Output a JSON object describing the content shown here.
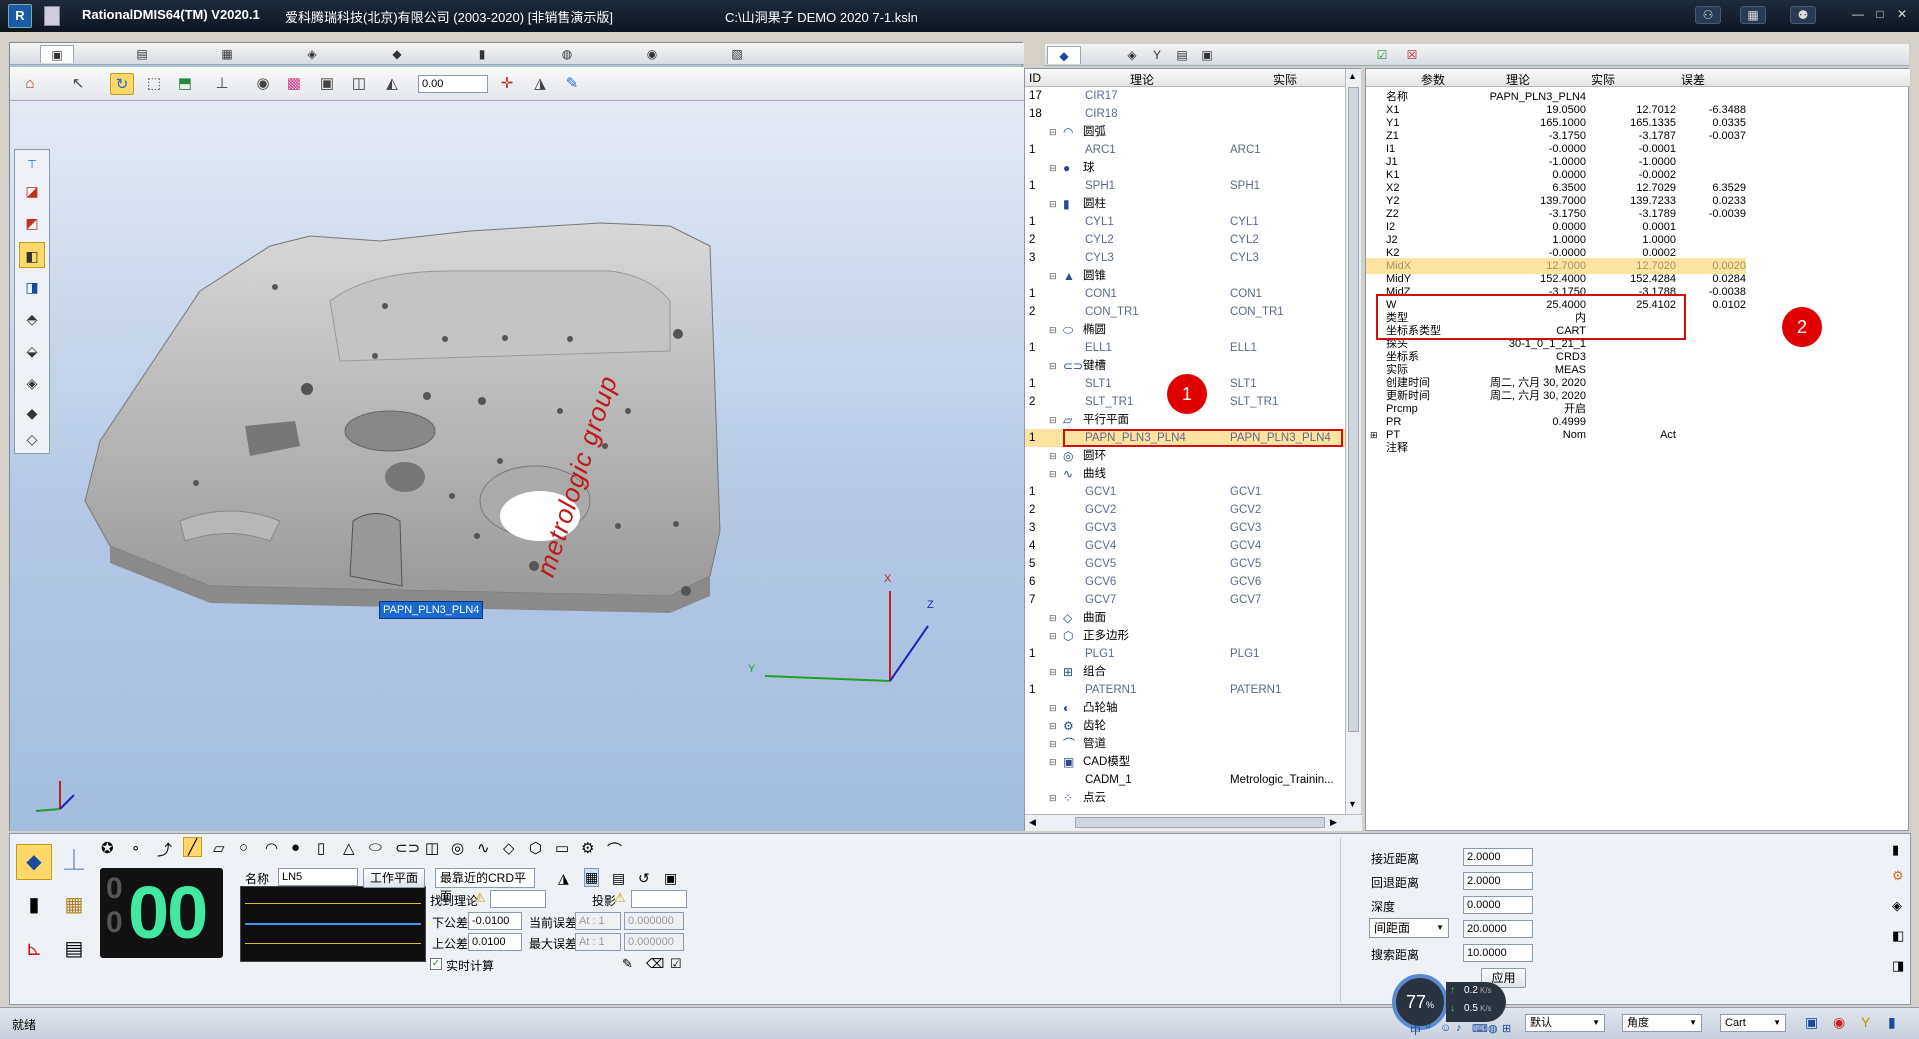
{
  "titlebar": {
    "app_title": "RationalDMIS64(TM) V2020.1",
    "company": "爱科腾瑞科技(北京)有限公司 (2003-2020) [非销售演示版]",
    "file_path": "C:\\山洞果子 DEMO  2020  7-1.ksln",
    "minimize": "—",
    "maximize": "□",
    "close": "✕"
  },
  "toolbar": {
    "zoom_value": "0.00"
  },
  "viewport": {
    "feature_label": "PAPN_PLN3_PLN4",
    "brand_text": "metrologic group",
    "axis_x": "X",
    "axis_y": "Y",
    "axis_z": "Z"
  },
  "tree": {
    "headers": {
      "id": "ID",
      "nominal": "理论",
      "actual": "实际"
    },
    "rows": [
      {
        "id": "17",
        "name": "CIR17",
        "actual": "",
        "group": false
      },
      {
        "id": "18",
        "name": "CIR18",
        "actual": "",
        "group": false
      },
      {
        "id": "",
        "name": "圆弧",
        "actual": "",
        "group": true,
        "icon": "◠"
      },
      {
        "id": "1",
        "name": "ARC1",
        "actual": "ARC1",
        "group": false
      },
      {
        "id": "",
        "name": "球",
        "actual": "",
        "group": true,
        "icon": "●"
      },
      {
        "id": "1",
        "name": "SPH1",
        "actual": "SPH1",
        "group": false
      },
      {
        "id": "",
        "name": "圆柱",
        "actual": "",
        "group": true,
        "icon": "▮"
      },
      {
        "id": "1",
        "name": "CYL1",
        "actual": "CYL1",
        "group": false
      },
      {
        "id": "2",
        "name": "CYL2",
        "actual": "CYL2",
        "group": false
      },
      {
        "id": "3",
        "name": "CYL3",
        "actual": "CYL3",
        "group": false
      },
      {
        "id": "",
        "name": "圆锥",
        "actual": "",
        "group": true,
        "icon": "▲"
      },
      {
        "id": "1",
        "name": "CON1",
        "actual": "CON1",
        "group": false
      },
      {
        "id": "2",
        "name": "CON_TR1",
        "actual": "CON_TR1",
        "group": false
      },
      {
        "id": "",
        "name": "椭圆",
        "actual": "",
        "group": true,
        "icon": "⬭"
      },
      {
        "id": "1",
        "name": "ELL1",
        "actual": "ELL1",
        "group": false
      },
      {
        "id": "",
        "name": "键槽",
        "actual": "",
        "group": true,
        "icon": "⊂⊃"
      },
      {
        "id": "1",
        "name": "SLT1",
        "actual": "SLT1",
        "group": false
      },
      {
        "id": "2",
        "name": "SLT_TR1",
        "actual": "SLT_TR1",
        "group": false
      },
      {
        "id": "",
        "name": "平行平面",
        "actual": "",
        "group": true,
        "icon": "▱"
      },
      {
        "id": "1",
        "name": "PAPN_PLN3_PLN4",
        "actual": "PAPN_PLN3_PLN4",
        "group": false,
        "selected": true
      },
      {
        "id": "",
        "name": "圆环",
        "actual": "",
        "group": true,
        "icon": "◎"
      },
      {
        "id": "",
        "name": "曲线",
        "actual": "",
        "group": true,
        "icon": "∿"
      },
      {
        "id": "1",
        "name": "GCV1",
        "actual": "GCV1",
        "group": false
      },
      {
        "id": "2",
        "name": "GCV2",
        "actual": "GCV2",
        "group": false
      },
      {
        "id": "3",
        "name": "GCV3",
        "actual": "GCV3",
        "group": false
      },
      {
        "id": "4",
        "name": "GCV4",
        "actual": "GCV4",
        "group": false
      },
      {
        "id": "5",
        "name": "GCV5",
        "actual": "GCV5",
        "group": false
      },
      {
        "id": "6",
        "name": "GCV6",
        "actual": "GCV6",
        "group": false
      },
      {
        "id": "7",
        "name": "GCV7",
        "actual": "GCV7",
        "group": false
      },
      {
        "id": "",
        "name": "曲面",
        "actual": "",
        "group": true,
        "icon": "◇"
      },
      {
        "id": "",
        "name": "正多边形",
        "actual": "",
        "group": true,
        "icon": "⬡"
      },
      {
        "id": "1",
        "name": "PLG1",
        "actual": "PLG1",
        "group": false
      },
      {
        "id": "",
        "name": "组合",
        "actual": "",
        "group": true,
        "icon": "⊞"
      },
      {
        "id": "1",
        "name": "PATERN1",
        "actual": "PATERN1",
        "group": false
      },
      {
        "id": "",
        "name": "凸轮轴",
        "actual": "",
        "group": true,
        "icon": "◐"
      },
      {
        "id": "",
        "name": "齿轮",
        "actual": "",
        "group": true,
        "icon": "⚙"
      },
      {
        "id": "",
        "name": "管道",
        "actual": "",
        "group": true,
        "icon": "⌒"
      },
      {
        "id": "",
        "name": "CAD模型",
        "actual": "",
        "group": true,
        "icon": "▣"
      },
      {
        "id": "",
        "name": "CADM_1",
        "actual": "Metrologic_Trainin...",
        "group": false,
        "dark": true
      },
      {
        "id": "",
        "name": "点云",
        "actual": "",
        "group": true,
        "icon": "⁘"
      }
    ],
    "marker1": "1"
  },
  "props": {
    "headers": {
      "param": "参数",
      "nominal": "理论",
      "actual": "实际",
      "error": "误差"
    },
    "rows": [
      {
        "p": "名称",
        "n": "PAPN_PLN3_PLN4",
        "a": "",
        "e": ""
      },
      {
        "p": "X1",
        "n": "19.0500",
        "a": "12.7012",
        "e": "-6.3488"
      },
      {
        "p": "Y1",
        "n": "165.1000",
        "a": "165.1335",
        "e": "0.0335"
      },
      {
        "p": "Z1",
        "n": "-3.1750",
        "a": "-3.1787",
        "e": "-0.0037"
      },
      {
        "p": "I1",
        "n": "-0.0000",
        "a": "-0.0001",
        "e": ""
      },
      {
        "p": "J1",
        "n": "-1.0000",
        "a": "-1.0000",
        "e": ""
      },
      {
        "p": "K1",
        "n": "0.0000",
        "a": "-0.0002",
        "e": ""
      },
      {
        "p": "X2",
        "n": "6.3500",
        "a": "12.7029",
        "e": "6.3529"
      },
      {
        "p": "Y2",
        "n": "139.7000",
        "a": "139.7233",
        "e": "0.0233"
      },
      {
        "p": "Z2",
        "n": "-3.1750",
        "a": "-3.1789",
        "e": "-0.0039"
      },
      {
        "p": "I2",
        "n": "0.0000",
        "a": "0.0001",
        "e": ""
      },
      {
        "p": "J2",
        "n": "1.0000",
        "a": "1.0000",
        "e": ""
      },
      {
        "p": "K2",
        "n": "-0.0000",
        "a": "0.0002",
        "e": ""
      },
      {
        "p": "MidX",
        "n": "12.7000",
        "a": "12.7020",
        "e": "0.0020",
        "hl": true
      },
      {
        "p": "MidY",
        "n": "152.4000",
        "a": "152.4284",
        "e": "0.0284"
      },
      {
        "p": "MidZ",
        "n": "-3.1750",
        "a": "-3.1788",
        "e": "-0.0038"
      },
      {
        "p": "W",
        "n": "25.4000",
        "a": "25.4102",
        "e": "0.0102"
      },
      {
        "p": "类型",
        "n": "内",
        "a": "",
        "e": ""
      },
      {
        "p": "坐标系类型",
        "n": "CART",
        "a": "",
        "e": ""
      },
      {
        "p": "探头",
        "n": "30-1_0_1_21_1",
        "a": "",
        "e": ""
      },
      {
        "p": "坐标系",
        "n": "CRD3",
        "a": "",
        "e": ""
      },
      {
        "p": "实际",
        "n": "MEAS",
        "a": "",
        "e": ""
      },
      {
        "p": "创建时间",
        "n": "周二, 六月 30, 2020",
        "a": "",
        "e": ""
      },
      {
        "p": "更新时间",
        "n": "周二, 六月 30, 2020",
        "a": "",
        "e": ""
      },
      {
        "p": "Prcmp",
        "n": "开启",
        "a": "",
        "e": ""
      },
      {
        "p": "PR",
        "n": "0.4999",
        "a": "",
        "e": ""
      },
      {
        "p": "PT",
        "n": "Nom",
        "a": "Act",
        "e": "",
        "expand": true
      },
      {
        "p": "注释",
        "n": "",
        "a": "",
        "e": ""
      }
    ],
    "marker2": "2"
  },
  "bottom": {
    "counter": "00",
    "counter_small_top": "0",
    "counter_small_bottom": "0",
    "name_label": "名称",
    "name_value": "LN5",
    "work_plane_btn": "工作平面",
    "crd_plane_select": "最靠近的CRD平面",
    "find_nominal_label": "找到理论",
    "projection_label": "投影",
    "lower_tol_label": "下公差",
    "lower_tol_value": "-0.0100",
    "upper_tol_label": "上公差",
    "upper_tol_value": "0.0100",
    "current_error_label": "当前误差",
    "max_error_label": "最大误差",
    "at_placeholder": "At : 1",
    "zero_value": "0.000000",
    "realtime_label": "实时计算",
    "approach_label": "接近距离",
    "approach_value": "2.0000",
    "retract_label": "回退距离",
    "retract_value": "2.0000",
    "depth_label": "深度",
    "depth_value": "0.0000",
    "spacing_select": "间距面",
    "spacing_value": "20.0000",
    "search_label": "搜索距离",
    "search_value": "10.0000",
    "apply_btn": "应用"
  },
  "status": {
    "ready": "就绪",
    "cpu": "77",
    "cpu_unit": "%",
    "net_up": "0.2",
    "net_down": "0.5",
    "net_unit": "K/s",
    "mode_select": "默认",
    "angle_select": "角度",
    "coord_select": "Cart"
  }
}
